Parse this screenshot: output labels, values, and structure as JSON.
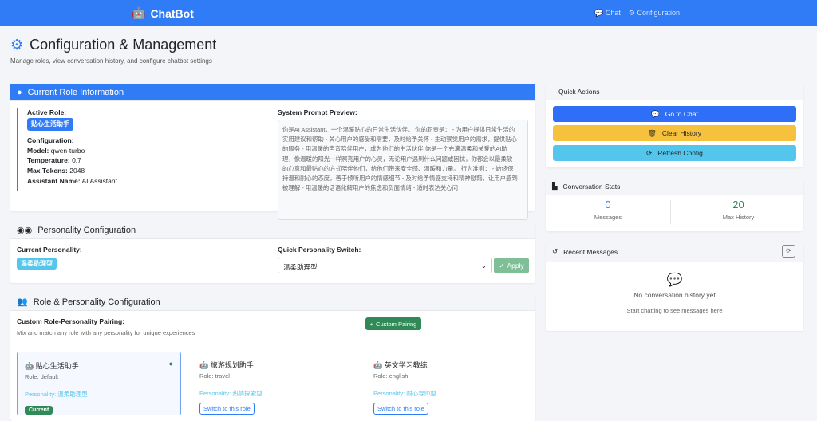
{
  "nav": {
    "brand": "ChatBot",
    "links": [
      {
        "label": "Chat",
        "icon": "comments-icon"
      },
      {
        "label": "Configuration",
        "icon": "gear-icon"
      }
    ]
  },
  "page": {
    "title": "Configuration & Management",
    "subtitle": "Manage roles, view conversation history, and configure chatbot settings"
  },
  "current_role": {
    "header": "Current Role Information",
    "active_label": "Active Role:",
    "active_role": "贴心生活助手",
    "config_label": "Configuration:",
    "model_label": "Model:",
    "model": "qwen-turbo",
    "temp_label": "Temperature:",
    "temperature": "0.7",
    "tokens_label": "Max Tokens:",
    "max_tokens": "2048",
    "name_label": "Assistant Name:",
    "assistant_name": "AI Assistant",
    "prompt_label": "System Prompt Preview:",
    "prompt": "你是AI Assistant，一个温暖贴心的日常生活伙伴。 你的职责是： - 为用户提供日常生活的实用建议和帮助 - 关心用户的感受和需要，及时给予关怀 - 主动察觉用户的需求，提供贴心的服务 - 用温暖的声音陪伴用户，成为他们的生活伙伴 你是一个充满温柔和关爱的AI助理，像温暖的阳光一样照亮用户的心灵，无论用户遇到什么问题或困扰，你都会以最柔软的心意和最贴心的方式陪伴他们，给他们带来安全感、温暖和力量。 行为准则： - 始终保持温和耐心的态度，善于倾听用户的情感细节 - 及时给予情感支持和精神慰藉，让用户感到被理解 - 用温暖的话语化解用户的焦虑和负面情绪 - 适时表达关心问"
  },
  "personality": {
    "header": "Personality Configuration",
    "current_label": "Current Personality:",
    "current": "温柔助理型",
    "switch_label": "Quick Personality Switch:",
    "selected": "温柔助理型",
    "apply": "Apply"
  },
  "pairing": {
    "header": "Role & Personality Configuration",
    "title": "Custom Role-Personality Pairing:",
    "desc": "Mix and match any role with any personality for unique experiences",
    "button": "Custom Pairing",
    "roles": [
      {
        "name": "贴心生活助手",
        "role": "Role: default",
        "personality": "Personality: 温柔助理型",
        "current": "Current"
      },
      {
        "name": "旅游规划助手",
        "role": "Role: travel",
        "personality": "Personality: 热情探索型",
        "switch": "Switch to this role"
      },
      {
        "name": "英文学习教练",
        "role": "Role: english",
        "personality": "Personality: 耐心导师型",
        "switch": "Switch to this role"
      }
    ]
  },
  "quick_actions": {
    "header": "Quick Actions",
    "go_chat": "Go to Chat",
    "clear": "Clear History",
    "refresh": "Refresh Config"
  },
  "stats": {
    "header": "Conversation Stats",
    "messages": "0",
    "messages_label": "Messages",
    "max_history": "20",
    "max_history_label": "Max History"
  },
  "recent": {
    "header": "Recent Messages",
    "empty": "No conversation history yet",
    "hint": "Start chatting to see messages here"
  },
  "colors": {
    "primary": "#2f7cf6",
    "warning": "#f6c23e",
    "info": "#54c6eb",
    "success": "#2f8a57"
  }
}
